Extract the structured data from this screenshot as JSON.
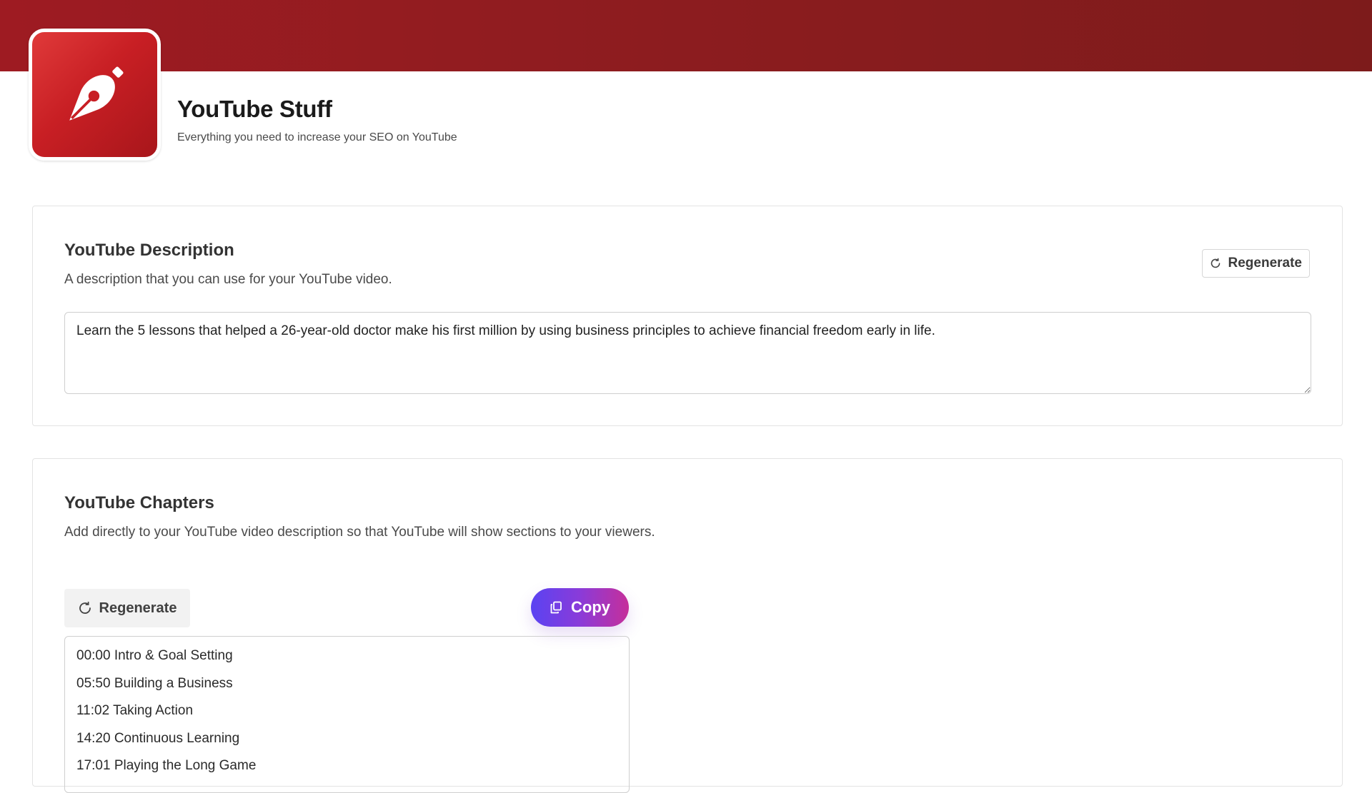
{
  "header": {
    "title": "YouTube Stuff",
    "subtitle": "Everything you need to increase your SEO on YouTube",
    "logo_icon": "fountain-pen-icon",
    "banner_color": "#8c1c1f",
    "logo_color": "#c81f24"
  },
  "description_section": {
    "title": "YouTube Description",
    "subtitle": "A description that you can use for your YouTube video.",
    "regenerate_label": "Regenerate",
    "text": "Learn the 5 lessons that helped a 26-year-old doctor make his first million by using business principles to achieve financial freedom early in life."
  },
  "chapters_section": {
    "title": "YouTube Chapters",
    "subtitle": "Add directly to your YouTube video description so that YouTube will show sections to your viewers.",
    "regenerate_label": "Regenerate",
    "copy_label": "Copy",
    "chapters": [
      "00:00 Intro & Goal Setting",
      "05:50 Building a Business",
      "11:02 Taking Action",
      "14:20 Continuous Learning",
      "17:01 Playing the Long Game"
    ]
  },
  "colors": {
    "copy_gradient_start": "#5a43f2",
    "copy_gradient_end": "#c62f9a"
  }
}
